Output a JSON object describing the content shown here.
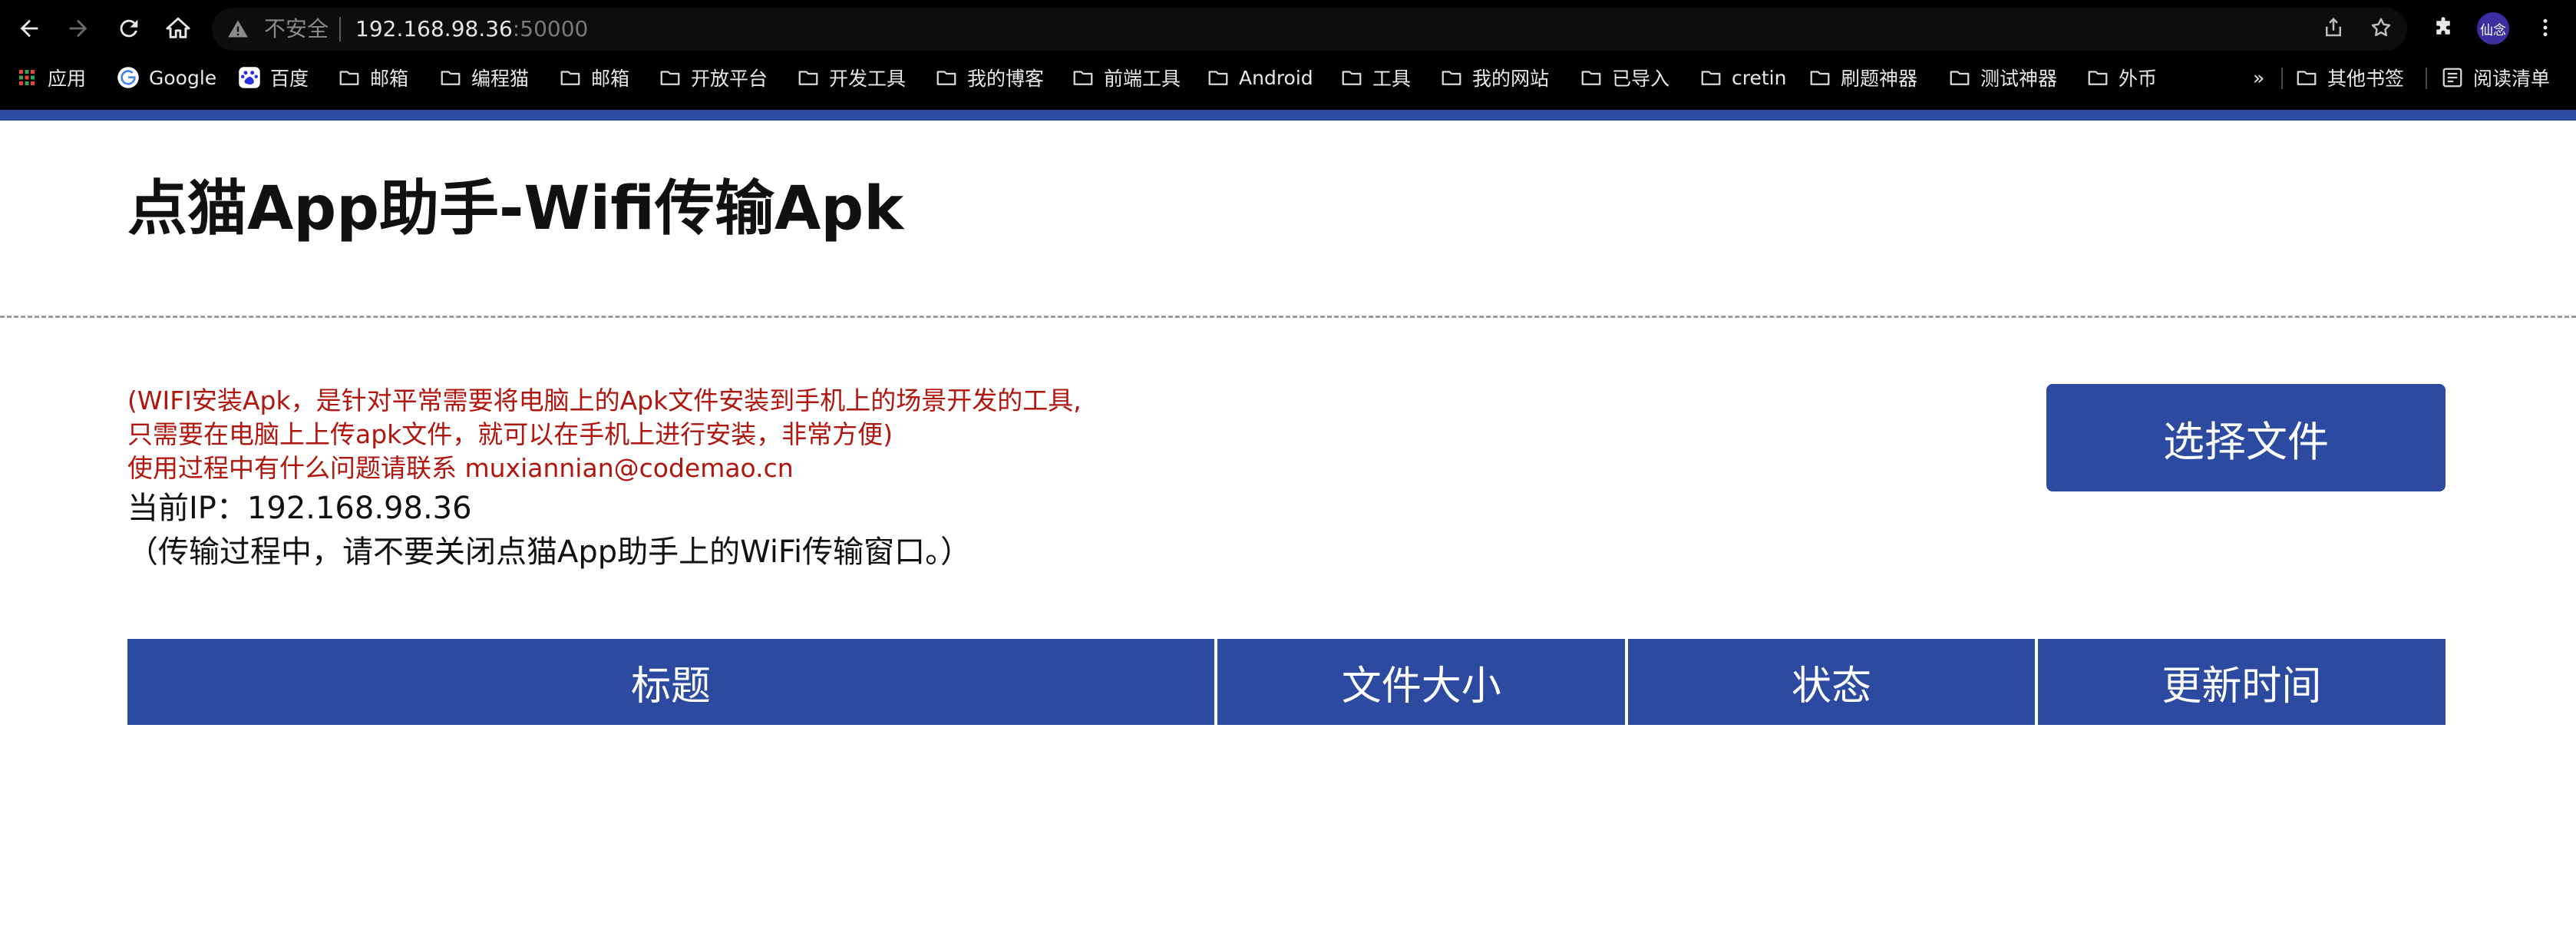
{
  "browser": {
    "security_label": "不安全",
    "url_host": "192.168.98.36",
    "url_port": ":50000",
    "profile_label": "仙念",
    "bookmarks": [
      {
        "label": "应用",
        "icon": "apps-grid-icon"
      },
      {
        "label": "Google",
        "icon": "google-icon"
      },
      {
        "label": "百度",
        "icon": "baidu-icon"
      },
      {
        "label": "邮箱",
        "icon": "folder-icon"
      },
      {
        "label": "编程猫",
        "icon": "folder-icon"
      },
      {
        "label": "邮箱",
        "icon": "folder-icon"
      },
      {
        "label": "开放平台",
        "icon": "folder-icon"
      },
      {
        "label": "开发工具",
        "icon": "folder-icon"
      },
      {
        "label": "我的博客",
        "icon": "folder-icon"
      },
      {
        "label": "前端工具",
        "icon": "folder-icon"
      },
      {
        "label": "Android",
        "icon": "folder-icon"
      },
      {
        "label": "工具",
        "icon": "folder-icon"
      },
      {
        "label": "我的网站",
        "icon": "folder-icon"
      },
      {
        "label": "已导入",
        "icon": "folder-icon"
      },
      {
        "label": "cretin",
        "icon": "folder-icon"
      },
      {
        "label": "刷题神器",
        "icon": "folder-icon"
      },
      {
        "label": "测试神器",
        "icon": "folder-icon"
      },
      {
        "label": "外币",
        "icon": "folder-icon"
      }
    ],
    "overflow_label": "»",
    "other_bookmarks": "其他书签",
    "reading_list": "阅读清单"
  },
  "page": {
    "title": "点猫App助手-Wifi传输Apk",
    "description_lines": [
      "(WIFI安装Apk，是针对平常需要将电脑上的Apk文件安装到手机上的场景开发的工具,",
      "只需要在电脑上上传apk文件，就可以在手机上进行安装，非常方便)",
      "使用过程中有什么问题请联系 muxiannian@codemao.cn"
    ],
    "current_ip": "当前IP：192.168.98.36",
    "notice": "（传输过程中，请不要关闭点猫App助手上的WiFi传输窗口。）",
    "choose_file_button": "选择文件",
    "table_headers": [
      "标题",
      "文件大小",
      "状态",
      "更新时间"
    ]
  },
  "colors": {
    "accent": "#2c4ba0",
    "warning_text": "#b0160e",
    "chrome_bg": "#000000"
  }
}
